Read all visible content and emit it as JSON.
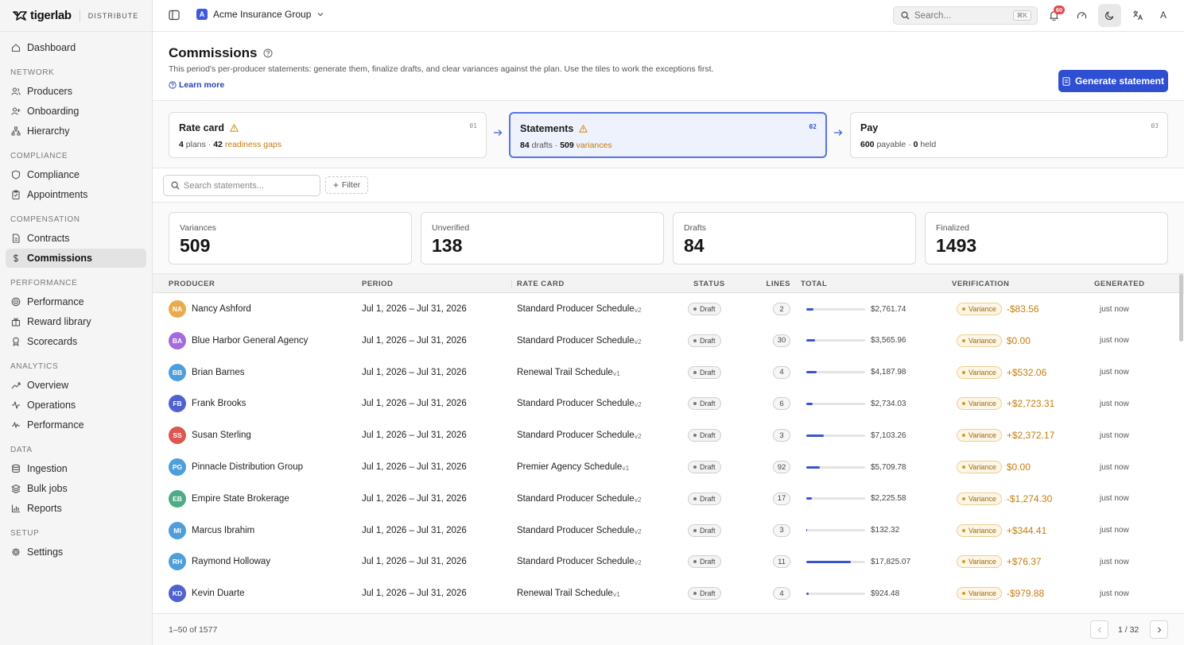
{
  "brand": {
    "logo": "tigerlab",
    "product": "DISTRIBUTE"
  },
  "sidebar": {
    "top_items": [
      {
        "label": "Dashboard",
        "icon": "home-icon"
      }
    ],
    "sections": [
      {
        "title": "NETWORK",
        "items": [
          {
            "label": "Producers",
            "icon": "users-icon"
          },
          {
            "label": "Onboarding",
            "icon": "user-plus-icon"
          },
          {
            "label": "Hierarchy",
            "icon": "hierarchy-icon"
          }
        ]
      },
      {
        "title": "COMPLIANCE",
        "items": [
          {
            "label": "Compliance",
            "icon": "shield-icon"
          },
          {
            "label": "Appointments",
            "icon": "clipboard-icon"
          }
        ]
      },
      {
        "title": "COMPENSATION",
        "items": [
          {
            "label": "Contracts",
            "icon": "document-icon"
          },
          {
            "label": "Commissions",
            "icon": "dollar-icon",
            "active": true
          }
        ]
      },
      {
        "title": "PERFORMANCE",
        "items": [
          {
            "label": "Performance",
            "icon": "target-icon"
          },
          {
            "label": "Reward library",
            "icon": "gift-icon"
          },
          {
            "label": "Scorecards",
            "icon": "award-icon"
          }
        ]
      },
      {
        "title": "ANALYTICS",
        "items": [
          {
            "label": "Overview",
            "icon": "trend-icon"
          },
          {
            "label": "Operations",
            "icon": "activity-icon"
          },
          {
            "label": "Performance",
            "icon": "pulse-icon"
          }
        ]
      },
      {
        "title": "DATA",
        "items": [
          {
            "label": "Ingestion",
            "icon": "database-icon"
          },
          {
            "label": "Bulk jobs",
            "icon": "layers-icon"
          },
          {
            "label": "Reports",
            "icon": "bar-chart-icon"
          }
        ]
      },
      {
        "title": "SETUP",
        "items": [
          {
            "label": "Settings",
            "icon": "gear-icon"
          }
        ]
      }
    ]
  },
  "topbar": {
    "org_initial": "A",
    "org_name": "Acme Insurance Group",
    "search_placeholder": "Search...",
    "search_shortcut": "⌘K",
    "notifications_count": "60",
    "user_initial": "A"
  },
  "page": {
    "title": "Commissions",
    "subtitle": "This period's per-producer statements: generate them, finalize drafts, and clear variances against the plan. Use the tiles to work the exceptions first.",
    "learn_more": "Learn more",
    "primary_action": "Generate statement"
  },
  "pipeline": [
    {
      "title": "Rate card",
      "num": "01",
      "warn": true,
      "n1": "4",
      "t1": "plans ·",
      "n2": "42",
      "t2": "readiness gaps",
      "t2_amber": true
    },
    {
      "title": "Statements",
      "num": "02",
      "warn": true,
      "active": true,
      "n1": "84",
      "t1": "drafts ·",
      "n2": "509",
      "t2": "variances",
      "t2_amber": true
    },
    {
      "title": "Pay",
      "num": "03",
      "warn": false,
      "n1": "600",
      "t1": "payable ·",
      "n2": "0",
      "t2": "held",
      "t2_amber": false
    }
  ],
  "toolbar": {
    "search_placeholder": "Search statements...",
    "filter_label": "Filter"
  },
  "kpis": [
    {
      "label": "Variances",
      "value": "509"
    },
    {
      "label": "Unverified",
      "value": "138"
    },
    {
      "label": "Drafts",
      "value": "84"
    },
    {
      "label": "Finalized",
      "value": "1493"
    }
  ],
  "table": {
    "columns": [
      "PRODUCER",
      "PERIOD",
      "RATE CARD",
      "STATUS",
      "LINES",
      "TOTAL",
      "VERIFICATION",
      "GENERATED"
    ],
    "rows": [
      {
        "initials": "NA",
        "avatar_color": "#e8a23a",
        "name": "Nancy Ashford",
        "period": "Jul 1, 2026 – Jul 31, 2026",
        "rate": "Standard Producer Schedule",
        "ver": "v2",
        "status": "Draft",
        "lines": "2",
        "bar": 0.12,
        "total": "$2,761.74",
        "verification": "Variance",
        "amount": "-$83.56",
        "generated": "just now"
      },
      {
        "initials": "BA",
        "avatar_color": "#9b5bd6",
        "name": "Blue Harbor General Agency",
        "period": "Jul 1, 2026 – Jul 31, 2026",
        "rate": "Standard Producer Schedule",
        "ver": "v2",
        "status": "Draft",
        "lines": "30",
        "bar": 0.15,
        "total": "$3,565.96",
        "verification": "Variance",
        "amount": "$0.00",
        "generated": "just now"
      },
      {
        "initials": "BB",
        "avatar_color": "#3b94d9",
        "name": "Brian Barnes",
        "period": "Jul 1, 2026 – Jul 31, 2026",
        "rate": "Renewal Trail Schedule",
        "ver": "v1",
        "status": "Draft",
        "lines": "4",
        "bar": 0.18,
        "total": "$4,187.98",
        "verification": "Variance",
        "amount": "+$532.06",
        "generated": "just now"
      },
      {
        "initials": "FB",
        "avatar_color": "#3c52c9",
        "name": "Frank Brooks",
        "period": "Jul 1, 2026 – Jul 31, 2026",
        "rate": "Standard Producer Schedule",
        "ver": "v2",
        "status": "Draft",
        "lines": "6",
        "bar": 0.11,
        "total": "$2,734.03",
        "verification": "Variance",
        "amount": "+$2,723.31",
        "generated": "just now"
      },
      {
        "initials": "SS",
        "avatar_color": "#d9453f",
        "name": "Susan Sterling",
        "period": "Jul 1, 2026 – Jul 31, 2026",
        "rate": "Standard Producer Schedule",
        "ver": "v2",
        "status": "Draft",
        "lines": "3",
        "bar": 0.3,
        "total": "$7,103.26",
        "verification": "Variance",
        "amount": "+$2,372.17",
        "generated": "just now"
      },
      {
        "initials": "PG",
        "avatar_color": "#3b94d9",
        "name": "Pinnacle Distribution Group",
        "period": "Jul 1, 2026 – Jul 31, 2026",
        "rate": "Premier Agency Schedule",
        "ver": "v1",
        "status": "Draft",
        "lines": "92",
        "bar": 0.23,
        "total": "$5,709.78",
        "verification": "Variance",
        "amount": "$0.00",
        "generated": "just now"
      },
      {
        "initials": "EB",
        "avatar_color": "#3aa37a",
        "name": "Empire State Brokerage",
        "period": "Jul 1, 2026 – Jul 31, 2026",
        "rate": "Standard Producer Schedule",
        "ver": "v2",
        "status": "Draft",
        "lines": "17",
        "bar": 0.09,
        "total": "$2,225.58",
        "verification": "Variance",
        "amount": "-$1,274.30",
        "generated": "just now"
      },
      {
        "initials": "MI",
        "avatar_color": "#3b94d9",
        "name": "Marcus Ibrahim",
        "period": "Jul 1, 2026 – Jul 31, 2026",
        "rate": "Standard Producer Schedule",
        "ver": "v2",
        "status": "Draft",
        "lines": "3",
        "bar": 0.01,
        "total": "$132.32",
        "verification": "Variance",
        "amount": "+$344.41",
        "generated": "just now"
      },
      {
        "initials": "RH",
        "avatar_color": "#3b94d9",
        "name": "Raymond Holloway",
        "period": "Jul 1, 2026 – Jul 31, 2026",
        "rate": "Standard Producer Schedule",
        "ver": "v2",
        "status": "Draft",
        "lines": "11",
        "bar": 0.75,
        "total": "$17,825.07",
        "verification": "Variance",
        "amount": "+$76.37",
        "generated": "just now"
      },
      {
        "initials": "KD",
        "avatar_color": "#3c52c9",
        "name": "Kevin Duarte",
        "period": "Jul 1, 2026 – Jul 31, 2026",
        "rate": "Renewal Trail Schedule",
        "ver": "v1",
        "status": "Draft",
        "lines": "4",
        "bar": 0.04,
        "total": "$924.48",
        "verification": "Variance",
        "amount": "-$979.88",
        "generated": "just now"
      }
    ]
  },
  "footer": {
    "range": "1–50 of 1577",
    "page": "1 / 32"
  }
}
